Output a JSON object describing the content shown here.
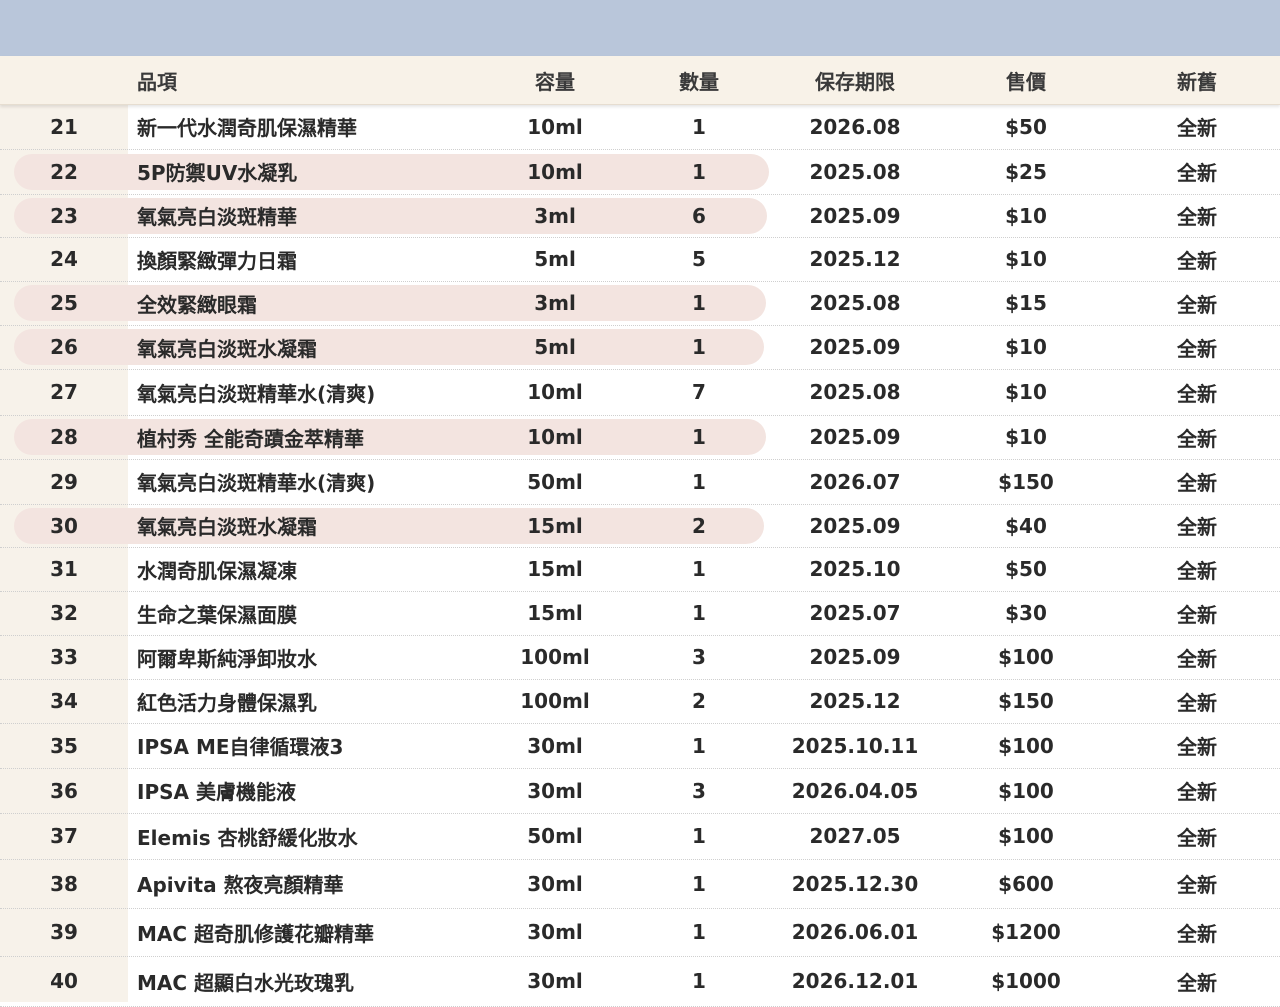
{
  "table": {
    "headers": {
      "index": "",
      "name": "品項",
      "volume": "容量",
      "quantity": "數量",
      "expiry": "保存期限",
      "price": "售價",
      "condition": "新舊"
    },
    "colors": {
      "top_band": "#b9c6da",
      "header_bg": "#f8f2e8",
      "index_column_bg": "#f7f2ea",
      "row_highlight": "#f3e4e0"
    },
    "rows": [
      {
        "no": "21",
        "name": "新一代水潤奇肌保濕精華",
        "volume": "10ml",
        "qty": "1",
        "expiry": "2026.08",
        "price": "$50",
        "condition": "全新",
        "highlighted": false
      },
      {
        "no": "22",
        "name": "5P防禦UV水凝乳",
        "volume": "10ml",
        "qty": "1",
        "expiry": "2025.08",
        "price": "$25",
        "condition": "全新",
        "highlighted": true
      },
      {
        "no": "23",
        "name": "氧氣亮白淡斑精華",
        "volume": "3ml",
        "qty": "6",
        "expiry": "2025.09",
        "price": "$10",
        "condition": "全新",
        "highlighted": true
      },
      {
        "no": "24",
        "name": "換顏緊緻彈力日霜",
        "volume": "5ml",
        "qty": "5",
        "expiry": "2025.12",
        "price": "$10",
        "condition": "全新",
        "highlighted": false
      },
      {
        "no": "25",
        "name": "全效緊緻眼霜",
        "volume": "3ml",
        "qty": "1",
        "expiry": "2025.08",
        "price": "$15",
        "condition": "全新",
        "highlighted": true
      },
      {
        "no": "26",
        "name": "氧氣亮白淡斑水凝霜",
        "volume": "5ml",
        "qty": "1",
        "expiry": "2025.09",
        "price": "$10",
        "condition": "全新",
        "highlighted": true
      },
      {
        "no": "27",
        "name": "氧氣亮白淡斑精華水(清爽)",
        "volume": "10ml",
        "qty": "7",
        "expiry": "2025.08",
        "price": "$10",
        "condition": "全新",
        "highlighted": false
      },
      {
        "no": "28",
        "name": "植村秀 全能奇蹟金萃精華",
        "volume": "10ml",
        "qty": "1",
        "expiry": "2025.09",
        "price": "$10",
        "condition": "全新",
        "highlighted": true
      },
      {
        "no": "29",
        "name": "氧氣亮白淡斑精華水(清爽)",
        "volume": "50ml",
        "qty": "1",
        "expiry": "2026.07",
        "price": "$150",
        "condition": "全新",
        "highlighted": false
      },
      {
        "no": "30",
        "name": "氧氣亮白淡斑水凝霜",
        "volume": "15ml",
        "qty": "2",
        "expiry": "2025.09",
        "price": "$40",
        "condition": "全新",
        "highlighted": true
      },
      {
        "no": "31",
        "name": "水潤奇肌保濕凝凍",
        "volume": "15ml",
        "qty": "1",
        "expiry": "2025.10",
        "price": "$50",
        "condition": "全新",
        "highlighted": false
      },
      {
        "no": "32",
        "name": "生命之葉保濕面膜",
        "volume": "15ml",
        "qty": "1",
        "expiry": "2025.07",
        "price": "$30",
        "condition": "全新",
        "highlighted": false
      },
      {
        "no": "33",
        "name": "阿爾卑斯純淨卸妝水",
        "volume": "100ml",
        "qty": "3",
        "expiry": "2025.09",
        "price": "$100",
        "condition": "全新",
        "highlighted": false
      },
      {
        "no": "34",
        "name": "紅色活力身體保濕乳",
        "volume": "100ml",
        "qty": "2",
        "expiry": "2025.12",
        "price": "$150",
        "condition": "全新",
        "highlighted": false
      },
      {
        "no": "35",
        "name": "IPSA ME自律循環液3",
        "volume": "30ml",
        "qty": "1",
        "expiry": "2025.10.11",
        "price": "$100",
        "condition": "全新",
        "highlighted": false
      },
      {
        "no": "36",
        "name": "IPSA 美膚機能液",
        "volume": "30ml",
        "qty": "3",
        "expiry": "2026.04.05",
        "price": "$100",
        "condition": "全新",
        "highlighted": false
      },
      {
        "no": "37",
        "name": "Elemis 杏桃舒緩化妝水",
        "volume": "50ml",
        "qty": "1",
        "expiry": "2027.05",
        "price": "$100",
        "condition": "全新",
        "highlighted": false
      },
      {
        "no": "38",
        "name": "Apivita 熬夜亮顏精華",
        "volume": "30ml",
        "qty": "1",
        "expiry": "2025.12.30",
        "price": "$600",
        "condition": "全新",
        "highlighted": false
      },
      {
        "no": "39",
        "name": "MAC 超奇肌修護花瓣精華",
        "volume": "30ml",
        "qty": "1",
        "expiry": "2026.06.01",
        "price": "$1200",
        "condition": "全新",
        "highlighted": false
      },
      {
        "no": "40",
        "name": "MAC 超顯白水光玫瑰乳",
        "volume": "30ml",
        "qty": "1",
        "expiry": "2026.12.01",
        "price": "$1000",
        "condition": "全新",
        "highlighted": false
      }
    ]
  }
}
